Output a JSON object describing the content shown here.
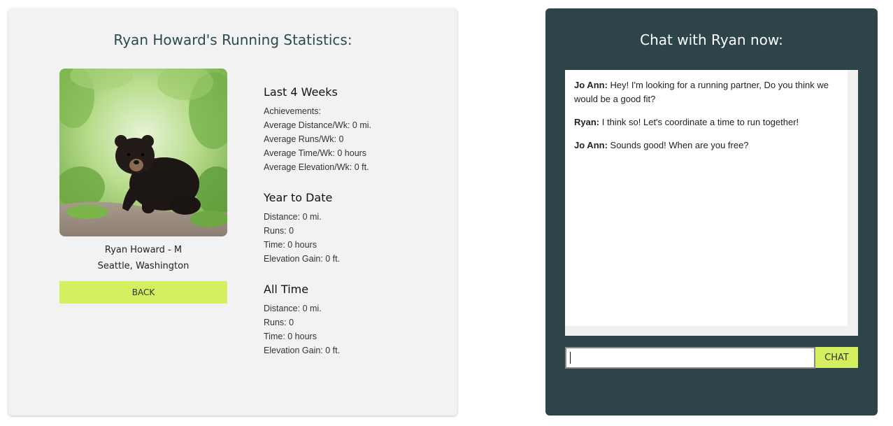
{
  "profile": {
    "title": "Ryan Howard's Running Statistics:",
    "name": "Ryan Howard - M",
    "location": "Seattle, Washington",
    "back_label": "BACK",
    "photo_alt": "black bear cub"
  },
  "stats": {
    "last4": {
      "heading": "Last 4 Weeks",
      "lines": [
        "Achievements:",
        "Average Distance/Wk: 0 mi.",
        "Average Runs/Wk: 0",
        "Average Time/Wk: 0 hours",
        "Average Elevation/Wk: 0 ft."
      ]
    },
    "ytd": {
      "heading": "Year to Date",
      "lines": [
        "Distance: 0 mi.",
        "Runs: 0",
        "Time: 0 hours",
        "Elevation Gain: 0 ft."
      ]
    },
    "alltime": {
      "heading": "All Time",
      "lines": [
        "Distance: 0 mi.",
        "Runs: 0",
        "Time: 0 hours",
        "Elevation Gain: 0 ft."
      ]
    }
  },
  "chat": {
    "title": "Chat with Ryan now:",
    "messages": [
      {
        "author": "Jo Ann:",
        "text": " Hey! I'm looking for a running partner, Do you think we would be a good fit?"
      },
      {
        "author": "Ryan:",
        "text": " I think so! Let's coordinate a time to run together!"
      },
      {
        "author": "Jo Ann:",
        "text": " Sounds good! When are you free?"
      }
    ],
    "input_value": "",
    "button_label": "CHAT"
  },
  "colors": {
    "accent": "#d4ef5f",
    "chat_panel": "#2d4548",
    "profile_panel": "#f2f2f2",
    "title_text": "#2c4a4c"
  }
}
